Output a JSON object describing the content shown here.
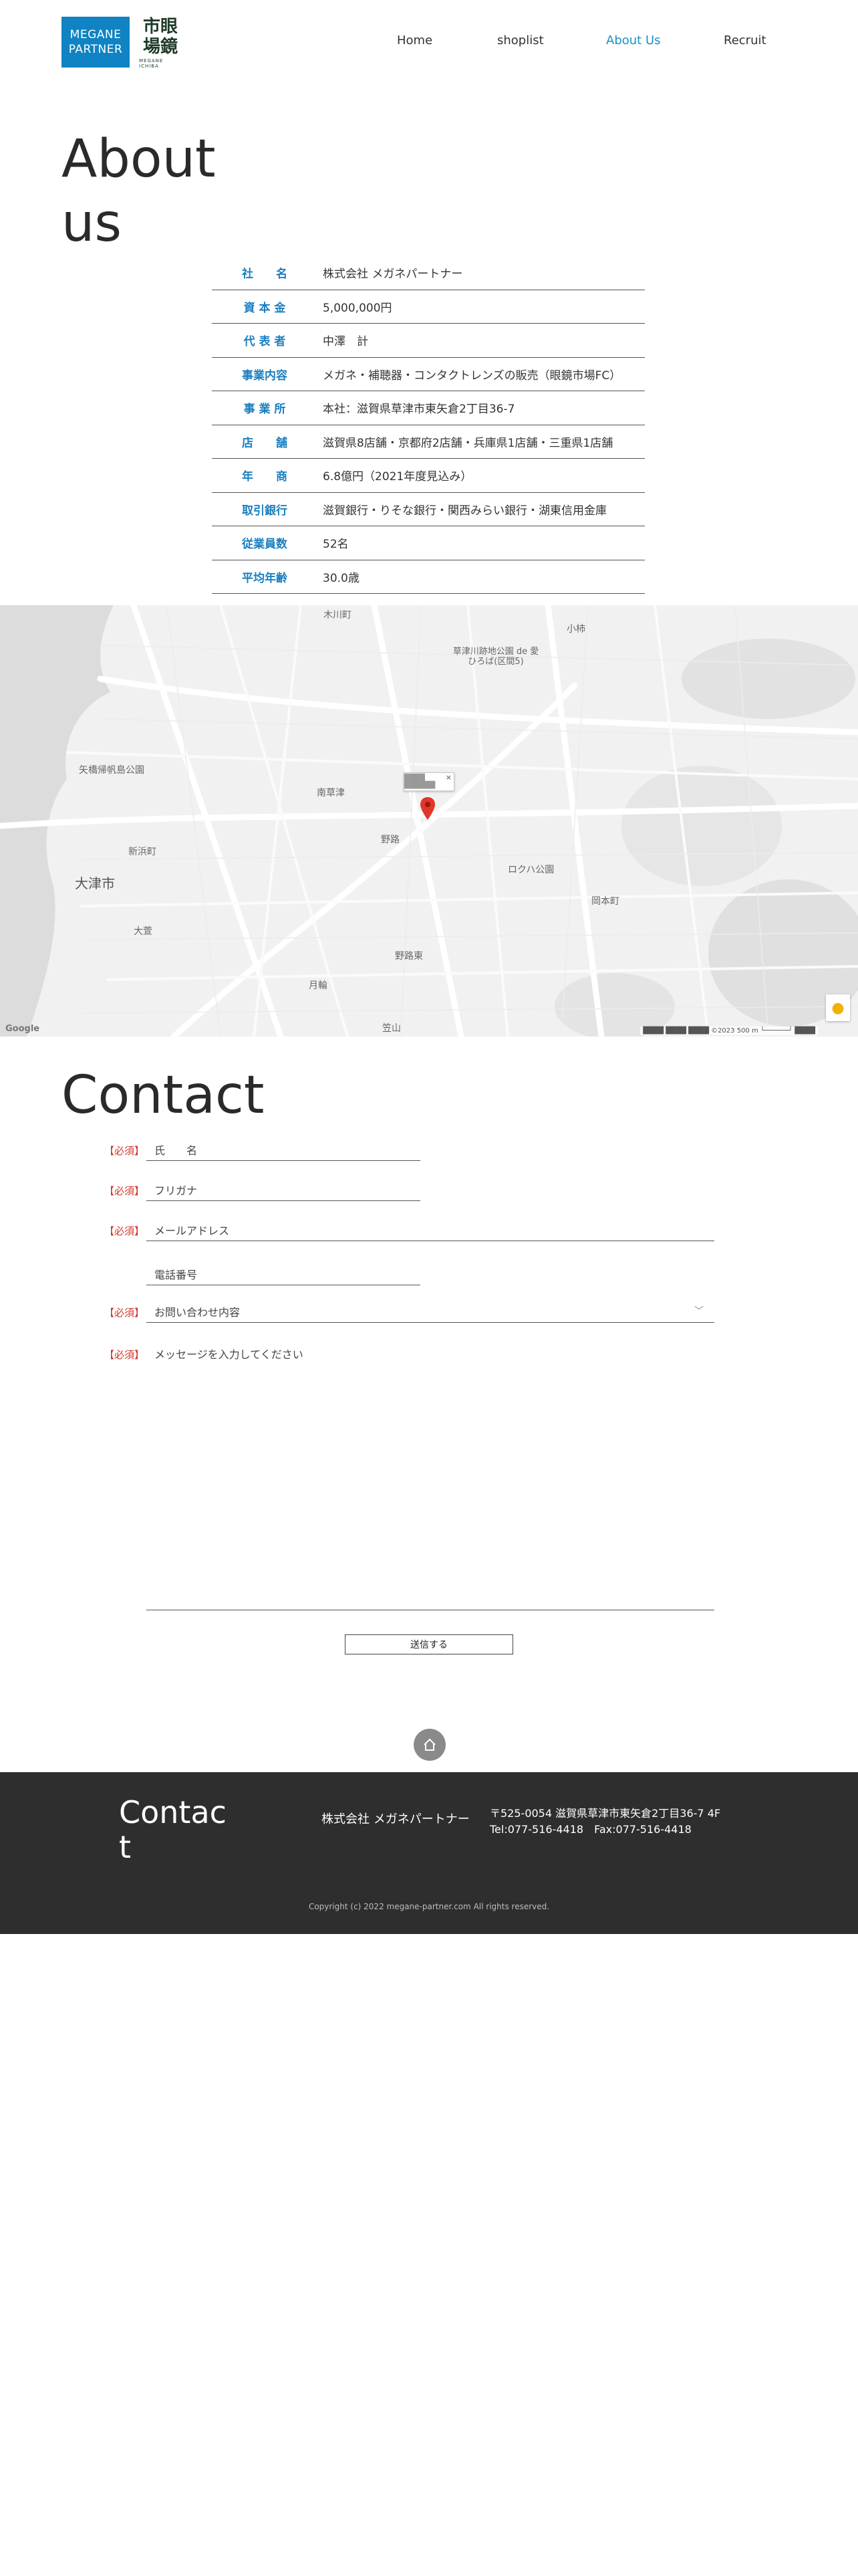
{
  "header": {
    "logo_line1": "MEGANE",
    "logo_line2": "PARTNER",
    "logo_kanji_1": "市眼",
    "logo_kanji_2": "場鏡",
    "logo_sub": "MEGANE ICHIBA",
    "nav": [
      {
        "label": "Home"
      },
      {
        "label": "shoplist"
      },
      {
        "label": "About Us",
        "active": true
      },
      {
        "label": "Recruit"
      }
    ]
  },
  "about": {
    "title": "About us",
    "rows": [
      {
        "key": "社　　名",
        "value": "株式会社 メガネパートナー"
      },
      {
        "key": "資 本 金",
        "value": "5,000,000円"
      },
      {
        "key": "代 表 者",
        "value": "中澤　計"
      },
      {
        "key": "事業内容",
        "value": "メガネ・補聴器・コンタクトレンズの販売（眼鏡市場FC）"
      },
      {
        "key": "事 業 所",
        "value": "本社：滋賀県草津市東矢倉2丁目36-7"
      },
      {
        "key": "店　　舗",
        "value": "滋賀県8店舗・京都府2店舗・兵庫県1店舗・三重県1店舗"
      },
      {
        "key": "年　　商",
        "value": "6.8億円（2021年度見込み）"
      },
      {
        "key": "取引銀行",
        "value": "滋賀銀行・りそな銀行・関西みらい銀行・湖東信用金庫"
      },
      {
        "key": "従業員数",
        "value": "52名"
      },
      {
        "key": "平均年齢",
        "value": "30.0歳"
      }
    ]
  },
  "map": {
    "places": {
      "city": "大津市",
      "p1": "矢橋帰帆島公園",
      "p2": "新浜町",
      "p3": "大萱",
      "p4": "南草津",
      "p5": "野路",
      "p6": "ロクハ公園",
      "p7": "野路東",
      "p8": "月輪",
      "p9": "草津川跡地公園 de 愛ひろば(区間5)",
      "p10": "岡本町",
      "p11": "小柿",
      "p12": "木川町",
      "p13": "笠山"
    },
    "popup_text": "████ ██████",
    "close_symbol": "×",
    "google": "Google",
    "attribution": "████ ████  ████ ©2023   500 m └──────┘  ████"
  },
  "contact": {
    "title": "Contact",
    "required_label": "【必須】",
    "name_placeholder": "氏　　名",
    "kana_placeholder": "フリガナ",
    "email_placeholder": "メールアドレス",
    "phone_placeholder": "電話番号",
    "inquiry_placeholder": "お問い合わせ内容",
    "message_placeholder": "メッセージを入力してください",
    "submit_label": "送信する"
  },
  "footer": {
    "title": "Contact",
    "company": "株式会社 メガネパートナー",
    "address": "〒525-0054 滋賀県草津市東矢倉2丁目36-7 4F",
    "tel_fax": "Tel:077-516-4418　Fax:077-516-4418",
    "copyright": "Copyright (c) 2022 megane-partner.com All rights reserved."
  },
  "colors": {
    "brand_blue": "#0f83c3",
    "accent_link": "#1a90c8",
    "required_red": "#d3372c",
    "footer_bg": "#2e2e2e"
  }
}
